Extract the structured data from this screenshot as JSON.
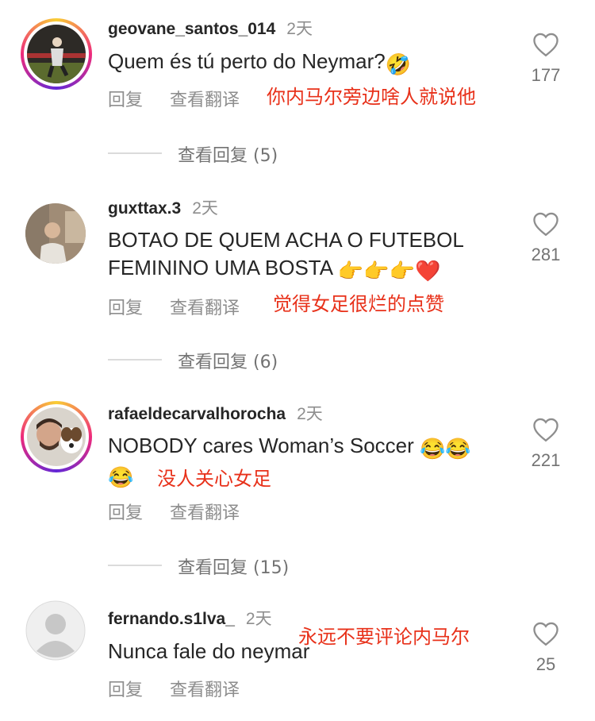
{
  "comments": [
    {
      "username": "geovane_santos_014",
      "time": "2天",
      "text": "Quem és tú perto do Neymar?",
      "text_emoji": "🤣",
      "reply_label": "回复",
      "translate_label": "查看翻译",
      "annotation": "你内马尔旁边啥人就说他",
      "likes": "177",
      "view_replies": "查看回复 (5)"
    },
    {
      "username": "guxttax.3",
      "time": "2天",
      "text_line1": "BOTAO DE QUEM ACHA O FUTEBOL",
      "text_line2": "FEMININO UMA BOSTA",
      "text_emoji": "👉👉👉❤️",
      "reply_label": "回复",
      "translate_label": "查看翻译",
      "annotation": "觉得女足很烂的点赞",
      "likes": "281",
      "view_replies": "查看回复 (6)"
    },
    {
      "username": "rafaeldecarvalhorocha",
      "time": "2天",
      "text_line1": "NOBODY cares  Woman’s Soccer",
      "text_emoji1": "😂😂",
      "text_emoji2": "😂",
      "reply_label": "回复",
      "translate_label": "查看翻译",
      "annotation": "没人关心女足",
      "likes": "221",
      "view_replies": "查看回复 (15)"
    },
    {
      "username": "fernando.s1lva_",
      "time": "2天",
      "text": "Nunca fale do neymar",
      "reply_label": "回复",
      "translate_label": "查看翻译",
      "annotation": "永远不要评论内马尔",
      "likes": "25"
    }
  ],
  "icons": {
    "like": "heart-outline-icon",
    "default_avatar": "default-avatar-icon"
  },
  "colors": {
    "annotation": "#e8311a",
    "secondary_text": "#8e8e8e",
    "primary_text": "#262626"
  }
}
